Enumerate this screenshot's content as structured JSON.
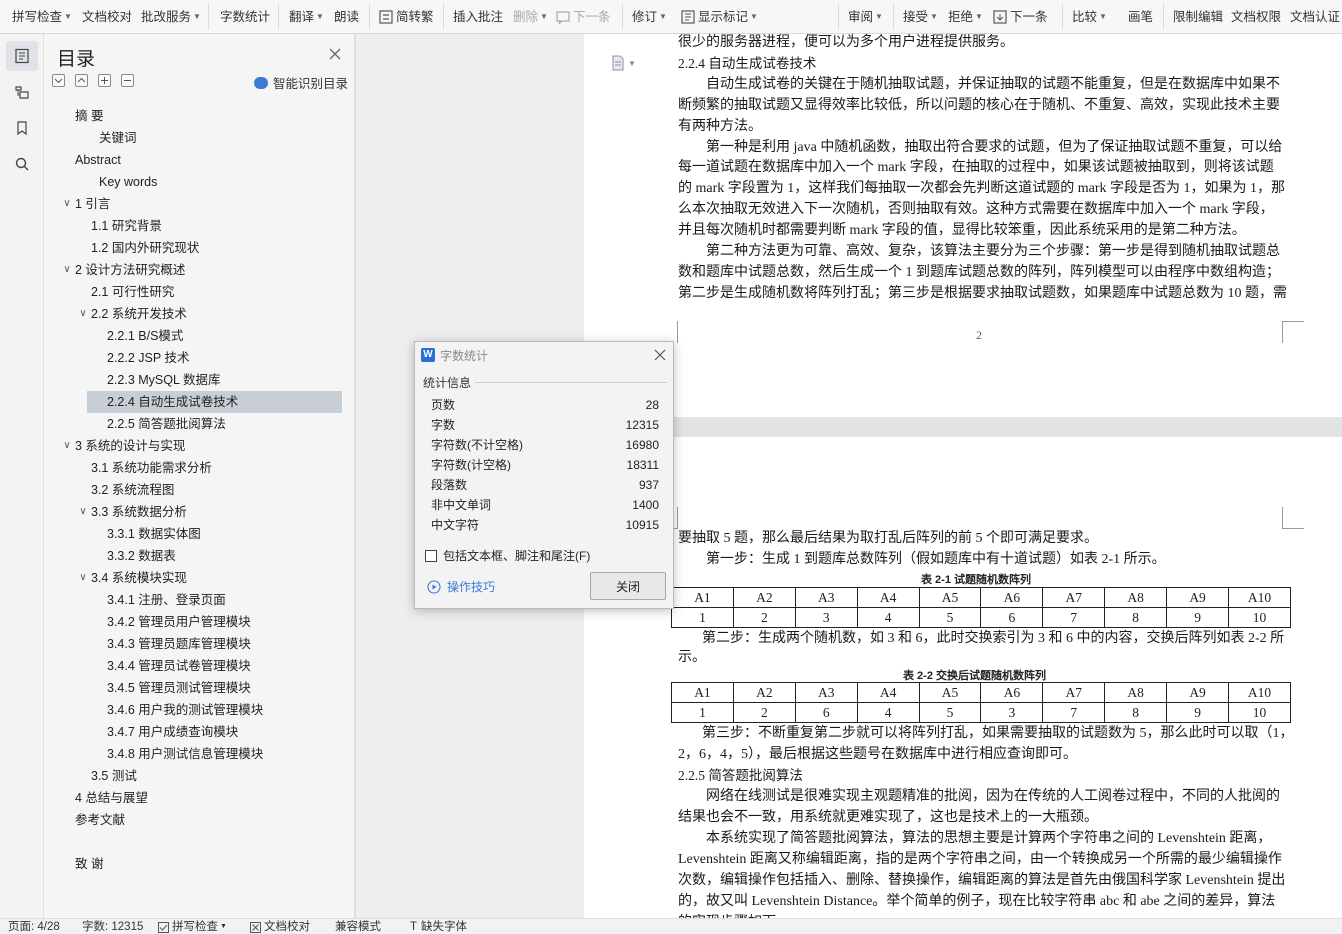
{
  "ribbon": {
    "spell_check": "拼写检查",
    "doc_proof": "文档校对",
    "batch_service": "批改服务",
    "word_count": "字数统计",
    "translate": "翻译",
    "read_aloud": "朗读",
    "trad_simp": "简转繁",
    "insert_comment": "插入批注",
    "delete": "删除",
    "next_comment": "下一条",
    "revise": "修订",
    "show_markup": "显示标记",
    "review": "审阅",
    "accept": "接受",
    "reject": "拒绝",
    "next_change": "下一条",
    "compare": "比较",
    "pen": "画笔",
    "restrict_edit": "限制编辑",
    "doc_permission": "文档权限",
    "doc_auth": "文档认证"
  },
  "toc": {
    "title": "目录",
    "smart_label": "智能识别目录",
    "items": [
      {
        "label": "摘    要"
      },
      {
        "label": "关键词"
      },
      {
        "label": "Abstract"
      },
      {
        "label": "Key words"
      },
      {
        "label": "1  引言"
      },
      {
        "label": "1.1  研究背景"
      },
      {
        "label": "1.2  国内外研究现状"
      },
      {
        "label": "2  设计方法研究概述"
      },
      {
        "label": "2.1  可行性研究"
      },
      {
        "label": "2.2  系统开发技术"
      },
      {
        "label": "2.2.1    B/S模式"
      },
      {
        "label": "2.2.2 JSP 技术"
      },
      {
        "label": "2.2.3 MySQL 数据库"
      },
      {
        "label": "2.2.4  自动生成试卷技术"
      },
      {
        "label": "2.2.5  简答题批阅算法"
      },
      {
        "label": "3  系统的设计与实现"
      },
      {
        "label": "3.1  系统功能需求分析"
      },
      {
        "label": "3.2  系统流程图"
      },
      {
        "label": "3.3  系统数据分析"
      },
      {
        "label": "3.3.1    数据实体图"
      },
      {
        "label": "3.3.2    数据表"
      },
      {
        "label": "3.4  系统模块实现"
      },
      {
        "label": "3.4.1  注册、登录页面"
      },
      {
        "label": "3.4.2  管理员用户管理模块"
      },
      {
        "label": "3.4.3  管理员题库管理模块"
      },
      {
        "label": "3.4.4  管理员试卷管理模块"
      },
      {
        "label": "3.4.5  管理员测试管理模块"
      },
      {
        "label": "3.4.6 用户我的测试管理模块"
      },
      {
        "label": "3.4.7 用户成绩查询模块"
      },
      {
        "label": "3.4.8 用户测试信息管理模块"
      },
      {
        "label": "3.5  测试"
      },
      {
        "label": "4  总结与展望"
      },
      {
        "label": "参考文献"
      },
      {
        "label": "致    谢"
      }
    ]
  },
  "document": {
    "page1_lines": [
      "很少的服务器进程，便可以为多个用户进程提供服务。",
      "2.2.4  自动生成试卷技术",
      "自动生成试卷的关键在于随机抽取试题，并保证抽取的试题不能重复，但是在数据库中如果不",
      "断频繁的抽取试题又显得效率比较低，所以问题的核心在于随机、不重复、高效，实现此技术主要",
      "有两种方法。",
      "第一种是利用 java 中随机函数，抽取出符合要求的试题，但为了保证抽取试题不重复，可以给",
      "每一道试题在数据库中加入一个 mark 字段，在抽取的过程中，如果该试题被抽取到，则将该试题",
      "的 mark 字段置为 1，这样我们每抽取一次都会先判断这道试题的 mark 字段是否为 1，如果为 1，那",
      "么本次抽取无效进入下一次随机，否则抽取有效。这种方式需要在数据库中加入一个 mark 字段，",
      "并且每次随机时都需要判断 mark 字段的值，显得比较笨重，因此系统采用的是第二种方法。",
      "第二种方法更为可靠、高效、复杂，该算法主要分为三个步骤：第一步是得到随机抽取试题总",
      "数和题库中试题总数，然后生成一个 1 到题库试题总数的阵列，阵列模型可以由程序中数组构造；",
      "第二步是生成随机数将阵列打乱；第三步是根据要求抽取试题数，如果题库中试题总数为 10 题，需"
    ],
    "page_number": "2",
    "page2_lines_a": [
      "要抽取 5 题，那么最后结果为取打乱后阵列的前 5 个即可满足要求。",
      "第一步：生成 1 到题库总数阵列（假如题库中有十道试题）如表 2-1 所示。"
    ],
    "table1_caption": "表 2-1  试题随机数阵列",
    "table1": {
      "header": [
        "A1",
        "A2",
        "A3",
        "A4",
        "A5",
        "A6",
        "A7",
        "A8",
        "A9",
        "A10"
      ],
      "row": [
        "1",
        "2",
        "3",
        "4",
        "5",
        "6",
        "7",
        "8",
        "9",
        "10"
      ]
    },
    "page2_lines_b": [
      "第二步：生成两个随机数，如 3 和 6，此时交换索引为 3 和 6 中的内容，交换后阵列如表 2-2 所",
      "示。"
    ],
    "table2_caption": "表 2-2  交换后试题随机数阵列",
    "table2": {
      "header": [
        "A1",
        "A2",
        "A3",
        "A4",
        "A5",
        "A6",
        "A7",
        "A8",
        "A9",
        "A10"
      ],
      "row": [
        "1",
        "2",
        "6",
        "4",
        "5",
        "3",
        "7",
        "8",
        "9",
        "10"
      ]
    },
    "page2_lines_c": [
      "第三步：不断重复第二步就可以将阵列打乱，如果需要抽取的试题数为 5，那么此时可以取（1，",
      "2，6，4，5），最后根据这些题号在数据库中进行相应查询即可。",
      "2.2.5  简答题批阅算法",
      "网络在线测试是很难实现主观题精准的批阅，因为在传统的人工阅卷过程中，不同的人批阅的",
      "结果也会不一致，用系统就更难实现了，这也是技术上的一大瓶颈。",
      "本系统实现了简答题批阅算法，算法的思想主要是计算两个字符串之间的 Levenshtein  距离，",
      "Levenshtein  距离又称编辑距离，指的是两个字符串之间，由一个转换成另一个所需的最少编辑操作",
      "次数，编辑操作包括插入、删除、替换操作，编辑距离的算法是首先由俄国科学家 Levenshtein 提出",
      "的，故又叫 Levenshtein Distance。举个简单的例子，现在比较字符串 abc 和 abe 之间的差异，算法",
      "的实现步骤如下"
    ]
  },
  "dialog": {
    "title": "字数统计",
    "group_label": "统计信息",
    "stats": [
      {
        "key": "页数",
        "value": "28"
      },
      {
        "key": "字数",
        "value": "12315"
      },
      {
        "key": "字符数(不计空格)",
        "value": "16980"
      },
      {
        "key": "字符数(计空格)",
        "value": "18311"
      },
      {
        "key": "段落数",
        "value": "937"
      },
      {
        "key": "非中文单词",
        "value": "1400"
      },
      {
        "key": "中文字符",
        "value": "10915"
      }
    ],
    "checkbox_label": "包括文本框、脚注和尾注(F)",
    "tips_label": "操作技巧",
    "close_label": "关闭"
  },
  "status": {
    "page": "页面: 4/28",
    "words": "字数: 12315",
    "spell": "拼写检查",
    "proof": "文档校对",
    "compat": "兼容模式",
    "missing_font": "缺失字体"
  }
}
